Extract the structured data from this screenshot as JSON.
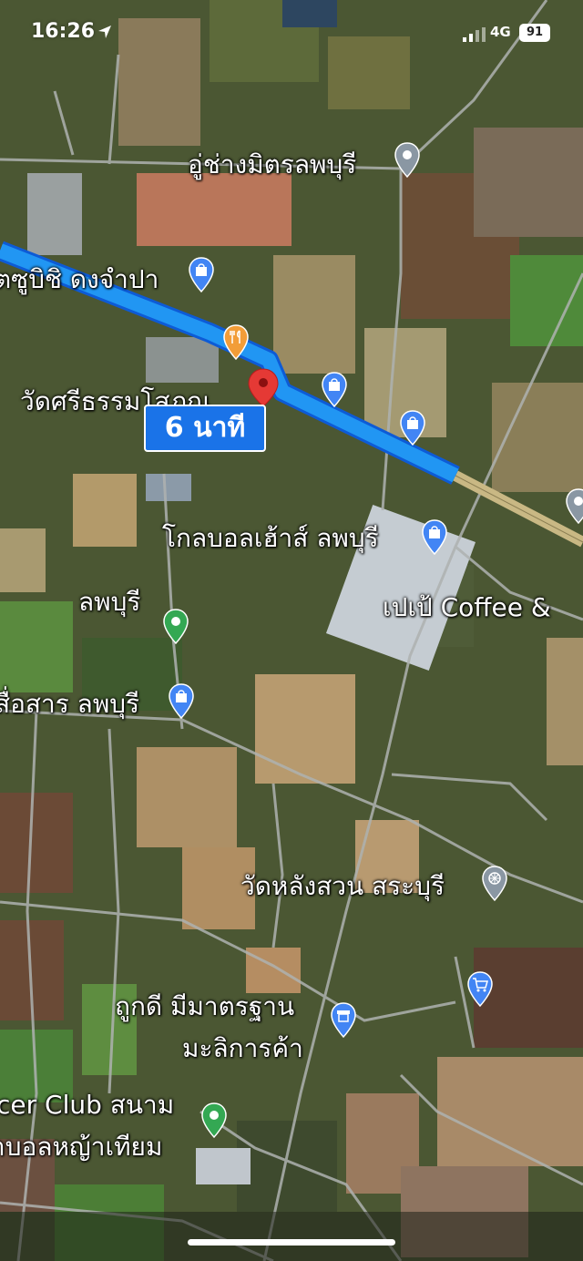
{
  "status_bar": {
    "time": "16:26",
    "network": "4G",
    "battery": "91"
  },
  "route": {
    "eta_label": "6 นาที",
    "route_color": "#2196f3"
  },
  "places": [
    {
      "name": "อู่ช่างมิตรลพบุรี",
      "icon": "place-pin-icon"
    },
    {
      "name": "ตซูบิชิ ดงจำปา",
      "icon": "shopping-bag-icon"
    },
    {
      "name": "วัดศรีธรรมโสภณ",
      "icon": "temple-icon"
    },
    {
      "name": "โกลบอลเฮ้าส์ ลพบุรี",
      "icon": "shopping-bag-icon"
    },
    {
      "name": "เปเป้ Coffee &",
      "icon": "cafe-icon"
    },
    {
      "name": "ลพบุรี",
      "icon": "park-icon"
    },
    {
      "name": "สื่อสาร ลพบุรี",
      "icon": "shopping-bag-icon"
    },
    {
      "name": "วัดหลังสวน สระบุรี",
      "icon": "dharma-wheel-icon"
    },
    {
      "name": "ถูกดี มีมาตรฐาน",
      "icon": "store-icon"
    },
    {
      "name": "มะลิการค้า",
      "icon": "store-icon"
    },
    {
      "name": "cer Club สนาม",
      "icon": "park-icon"
    },
    {
      "name": "าบอลหญ้าเทียม",
      "icon": "park-icon"
    }
  ]
}
